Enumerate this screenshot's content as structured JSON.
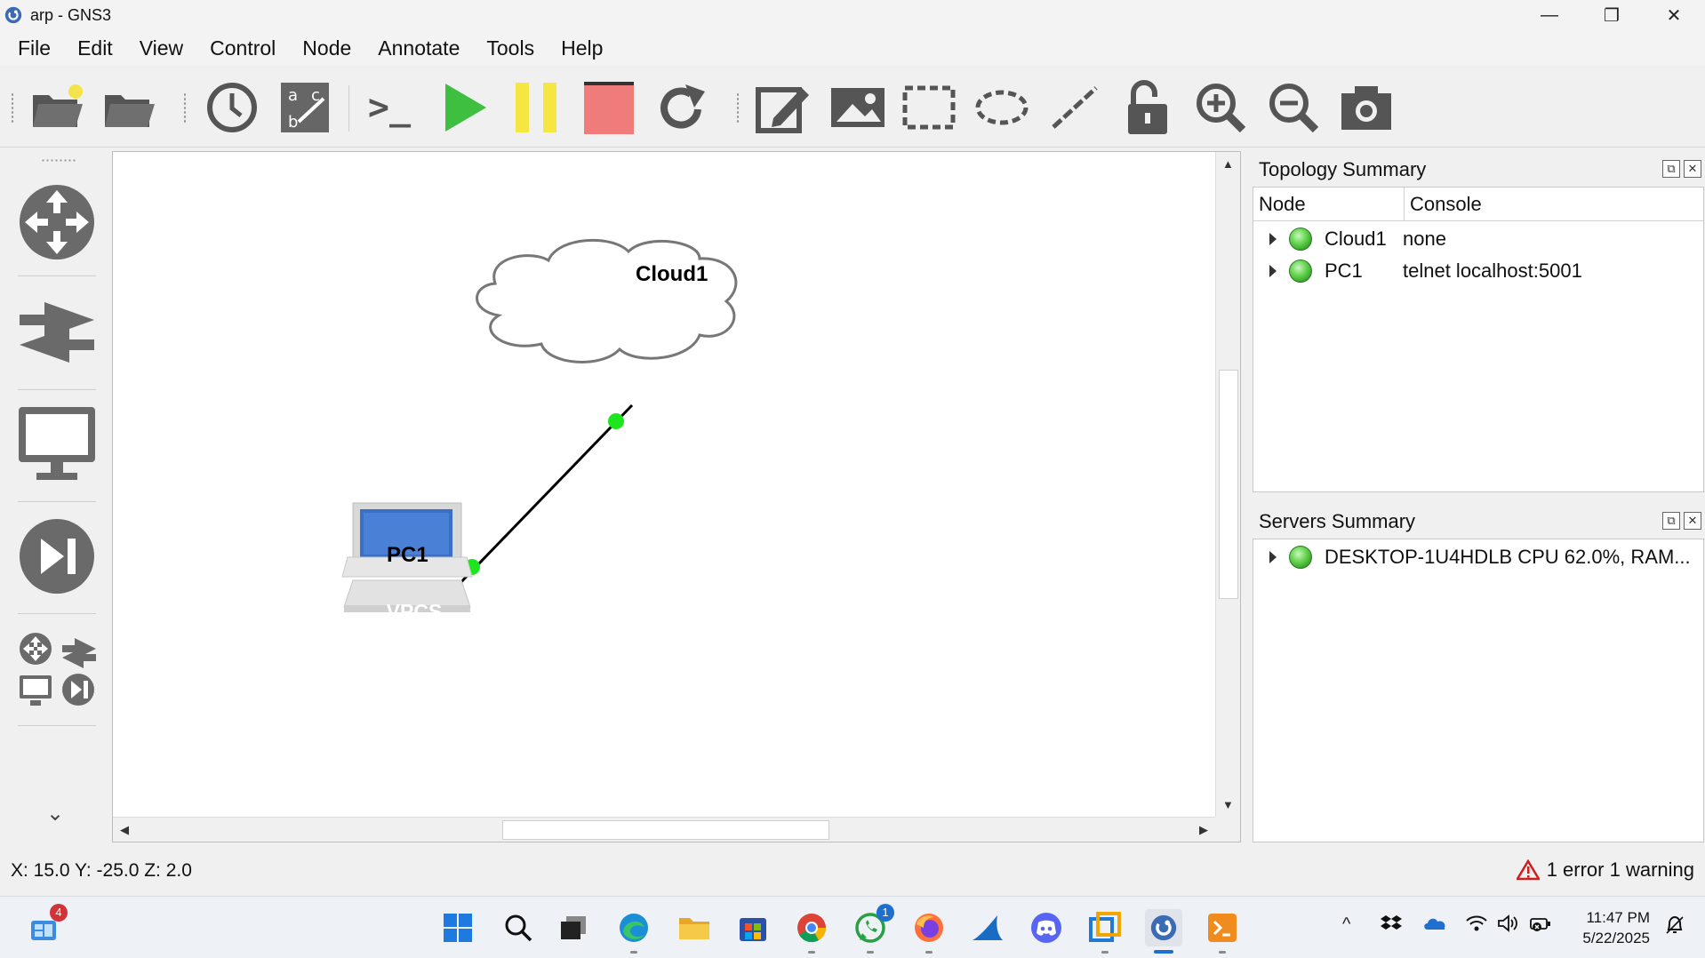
{
  "window": {
    "title": "arp - GNS3",
    "minimize_glyph": "—",
    "restore_glyph": "❐",
    "close_glyph": "✕"
  },
  "menu": [
    "File",
    "Edit",
    "View",
    "Control",
    "Node",
    "Annotate",
    "Tools",
    "Help"
  ],
  "toolbar": {
    "icons": [
      "new-project-icon",
      "open-project-icon",
      "snapshot-clock-icon",
      "show-interface-labels-icon",
      "console-all-icon",
      "start-all-icon",
      "suspend-all-icon",
      "stop-all-icon",
      "reload-all-icon",
      "add-note-icon",
      "insert-picture-icon",
      "draw-rectangle-icon",
      "draw-ellipse-icon",
      "draw-line-icon",
      "lock-unlock-icon",
      "zoom-in-icon",
      "zoom-out-icon",
      "screenshot-icon"
    ],
    "console_glyph": ">_",
    "abc_glyphs": [
      "a",
      "c",
      "b"
    ]
  },
  "left_panel": {
    "icons": [
      "routers-icon",
      "switches-icon",
      "end-devices-icon",
      "security-devices-icon",
      "all-devices-icon"
    ],
    "more_glyph": "⌄"
  },
  "canvas": {
    "nodes": [
      {
        "label": "Cloud1",
        "type": "cloud"
      },
      {
        "label": "PC1",
        "type": "vpcs",
        "badge": "VPCS"
      }
    ],
    "scroll_up": "▲",
    "scroll_down": "▼",
    "scroll_left": "◀",
    "scroll_right": "▶"
  },
  "topology_summary": {
    "title": "Topology Summary",
    "columns": [
      "Node",
      "Console"
    ],
    "rows": [
      {
        "node": "Cloud1",
        "console": "none"
      },
      {
        "node": "PC1",
        "console": "telnet localhost:5001"
      }
    ]
  },
  "servers_summary": {
    "title": "Servers Summary",
    "rows": [
      {
        "text": "DESKTOP-1U4HDLB CPU 62.0%, RAM..."
      }
    ]
  },
  "dock_buttons": {
    "float": "⧉",
    "close": "✕"
  },
  "status": {
    "coords": "X: 15.0 Y: -25.0 Z: 2.0",
    "warnings": "1 error 1 warning"
  },
  "taskbar": {
    "widgets_badge": "4",
    "whatsapp_badge": "1",
    "time": "11:47 PM",
    "date": "5/22/2025",
    "tray_overflow": "^"
  },
  "colors": {
    "link_dot": "#1ee61e",
    "start": "#3fbf3f",
    "suspend": "#f5e642",
    "stop": "#f07b7b",
    "accent": "#1f6fd1"
  }
}
